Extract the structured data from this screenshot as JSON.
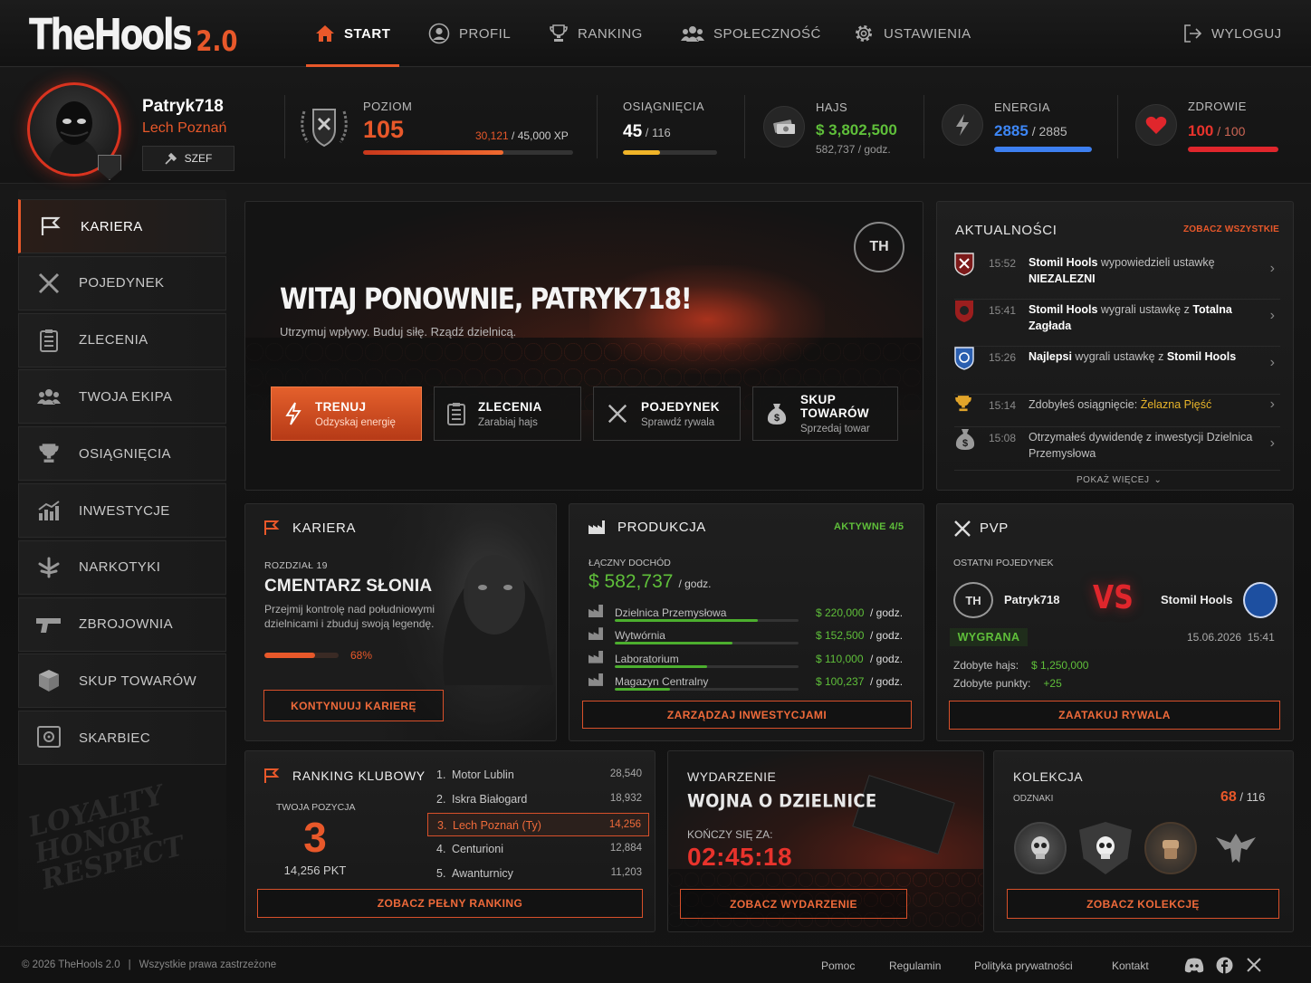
{
  "app": {
    "logo_main": "TheHools",
    "logo_version": "2.0"
  },
  "nav": {
    "items": [
      {
        "label": "START",
        "icon": "home-icon",
        "active": true
      },
      {
        "label": "PROFIL",
        "icon": "user-icon"
      },
      {
        "label": "RANKING",
        "icon": "trophy-icon"
      },
      {
        "label": "SPOŁECZNOŚĆ",
        "icon": "group-icon"
      },
      {
        "label": "USTAWIENIA",
        "icon": "gear-icon"
      }
    ],
    "logout": "WYLOGUJ"
  },
  "player": {
    "name": "Patryk718",
    "club": "Lech Poznań",
    "role": "SZEF"
  },
  "stats": {
    "level": {
      "label": "POZIOM",
      "value": "105",
      "xp_current": "30,121",
      "xp_max": "/ 45,000 XP",
      "progress": 0.67
    },
    "achievements": {
      "label": "OSIĄGNIĘCIA",
      "value": "45",
      "max": "/ 116",
      "progress": 0.39
    },
    "cash": {
      "label": "HAJS",
      "value": "$ 3,802,500",
      "rate": "582,737 / godz."
    },
    "energy": {
      "label": "ENERGIA",
      "value": "2885",
      "max": "/ 2885",
      "progress": 1.0
    },
    "health": {
      "label": "ZDROWIE",
      "value": "100",
      "max": "/ 100",
      "progress": 1.0
    }
  },
  "sidebar": {
    "items": [
      {
        "label": "KARIERA",
        "icon": "flag-icon",
        "active": true
      },
      {
        "label": "POJEDYNEK",
        "icon": "crossed-swords-icon"
      },
      {
        "label": "ZLECENIA",
        "icon": "clipboard-icon"
      },
      {
        "label": "TWOJA EKIPA",
        "icon": "group-icon"
      },
      {
        "label": "OSIĄGNIĘCIA",
        "icon": "trophy-icon"
      },
      {
        "label": "INWESTYCJE",
        "icon": "chart-icon"
      },
      {
        "label": "NARKOTYKI",
        "icon": "leaf-icon"
      },
      {
        "label": "ZBROJOWNIA",
        "icon": "pistol-icon"
      },
      {
        "label": "SKUP TOWARÓW",
        "icon": "boxes-icon"
      },
      {
        "label": "SKARBIEC",
        "icon": "safe-icon"
      }
    ]
  },
  "hero": {
    "title": "WITAJ PONOWNIE, PATRYK718!",
    "subtitle": "Utrzymuj wpływy. Buduj siłę. Rządź dzielnicą.",
    "emblem": "TH",
    "buttons": [
      {
        "title": "TRENUJ",
        "sub": "Odzyskaj energię",
        "icon": "lightning-icon",
        "primary": true
      },
      {
        "title": "ZLECENIA",
        "sub": "Zarabiaj hajs",
        "icon": "clipboard-icon"
      },
      {
        "title": "POJEDYNEK",
        "sub": "Sprawdź rywala",
        "icon": "crossed-swords-icon"
      },
      {
        "title": "SKUP TOWARÓW",
        "sub": "Sprzedaj towar",
        "icon": "money-bag-icon"
      }
    ]
  },
  "news": {
    "title": "AKTUALNOŚCI",
    "see_all": "ZOBACZ WSZYSTKIE",
    "items": [
      {
        "time": "15:52",
        "actor": "Stomil Hools",
        "text": " wypowiedzieli ustawkę ",
        "target": "NIEZALEZNI",
        "icon": "club-crest-red-icon"
      },
      {
        "time": "15:41",
        "actor": "Stomil Hools",
        "text": " wygrali ustawkę z ",
        "target": "Totalna Zagłada",
        "icon": "club-crest-dark-icon"
      },
      {
        "time": "15:26",
        "actor": "Najlepsi",
        "text": " wygrali ustawkę z ",
        "target": "Stomil Hools",
        "icon": "club-crest-blue-icon"
      },
      {
        "time": "15:14",
        "actor": "",
        "text": "Zdobyłeś osiągnięcie: ",
        "target": "Żelazna Pięść",
        "icon": "trophy-icon"
      },
      {
        "time": "15:08",
        "actor": "",
        "text": "Otrzymałeś dywidendę z inwestycji Dzielnica Przemysłowa",
        "target": "",
        "icon": "money-bag-icon"
      }
    ],
    "more": "POKAŻ WIĘCEJ"
  },
  "career": {
    "title": "KARIERA",
    "chapter": "ROZDZIAŁ 19",
    "name": "CMENTARZ SŁONIA",
    "desc": "Przejmij kontrolę nad południowymi dzielnicami i zbuduj swoją legendę.",
    "progress_label": "68%",
    "progress": 0.68,
    "button": "KONTYNUUJ KARIERĘ"
  },
  "production": {
    "title": "PRODUKCJA",
    "active": "AKTYWNE 4/5",
    "total_label": "ŁĄCZNY DOCHÓD",
    "total_value": "$ 582,737",
    "total_unit": "/ godz.",
    "rows": [
      {
        "name": "Dzielnica Przemysłowa",
        "value": "$ 220,000",
        "unit": "/ godz.",
        "progress": 0.78
      },
      {
        "name": "Wytwórnia",
        "value": "$ 152,500",
        "unit": "/ godz.",
        "progress": 0.64
      },
      {
        "name": "Laboratorium",
        "value": "$ 110,000",
        "unit": "/ godz.",
        "progress": 0.5
      },
      {
        "name": "Magazyn Centralny",
        "value": "$ 100,237",
        "unit": "/ godz.",
        "progress": 0.3
      }
    ],
    "button": "ZARZĄDZAJ INWESTYCJAMI"
  },
  "pvp": {
    "title": "PVP",
    "last": "OSTATNI POJEDYNEK",
    "player": "Patryk718",
    "player_emblem": "TH",
    "vs": "VS",
    "opponent": "Stomil Hools",
    "result": "WYGRANA",
    "date": "15.06.2026  15:41",
    "cash_label": "Zdobyte hajs:",
    "cash_value": "$ 1,250,000",
    "points_label": "Zdobyte punkty:",
    "points_value": "+25",
    "button": "ZAATAKUJ RYWALA"
  },
  "ranking": {
    "title": "RANKING KLUBOWY",
    "your_label": "TWOJA POZYCJA",
    "your_pos": "3",
    "your_pts": "14,256 PKT",
    "rows": [
      {
        "pos": "1.",
        "name": "Motor Lublin",
        "pts": "28,540"
      },
      {
        "pos": "2.",
        "name": "Iskra Białogard",
        "pts": "18,932"
      },
      {
        "pos": "3.",
        "name": "Lech Poznań (Ty)",
        "pts": "14,256",
        "me": true
      },
      {
        "pos": "4.",
        "name": "Centurioni",
        "pts": "12,884"
      },
      {
        "pos": "5.",
        "name": "Awanturnicy",
        "pts": "11,203"
      }
    ],
    "button": "ZOBACZ PEŁNY RANKING"
  },
  "event": {
    "label": "WYDARZENIE",
    "title": "WOJNA O DZIELNICE",
    "ends": "KOŃCZY SIĘ ZA:",
    "timer": "02:45:18",
    "button": "ZOBACZ WYDARZENIE"
  },
  "collection": {
    "title": "KOLEKCJA",
    "sub": "ODZNAKI",
    "count": "68",
    "max": "/ 116",
    "badges": [
      "skull-badge-icon",
      "skull-shield-badge-icon",
      "fist-badge-icon",
      "eagle-badge-icon"
    ],
    "button": "ZOBACZ KOLEKCJĘ"
  },
  "footer": {
    "copyright": "© 2026 TheHools 2.0",
    "sep": "|",
    "rights": "Wszystkie prawa zastrzeżone",
    "links": [
      "Pomoc",
      "Regulamin",
      "Polityka prywatności",
      "Kontakt"
    ],
    "social": [
      "discord-icon",
      "facebook-icon",
      "x-icon"
    ]
  },
  "colors": {
    "accent": "#e8582a",
    "green": "#5fbf3a",
    "energy": "#3d7ff0",
    "health": "#e0262c",
    "gold": "#f0b428"
  }
}
